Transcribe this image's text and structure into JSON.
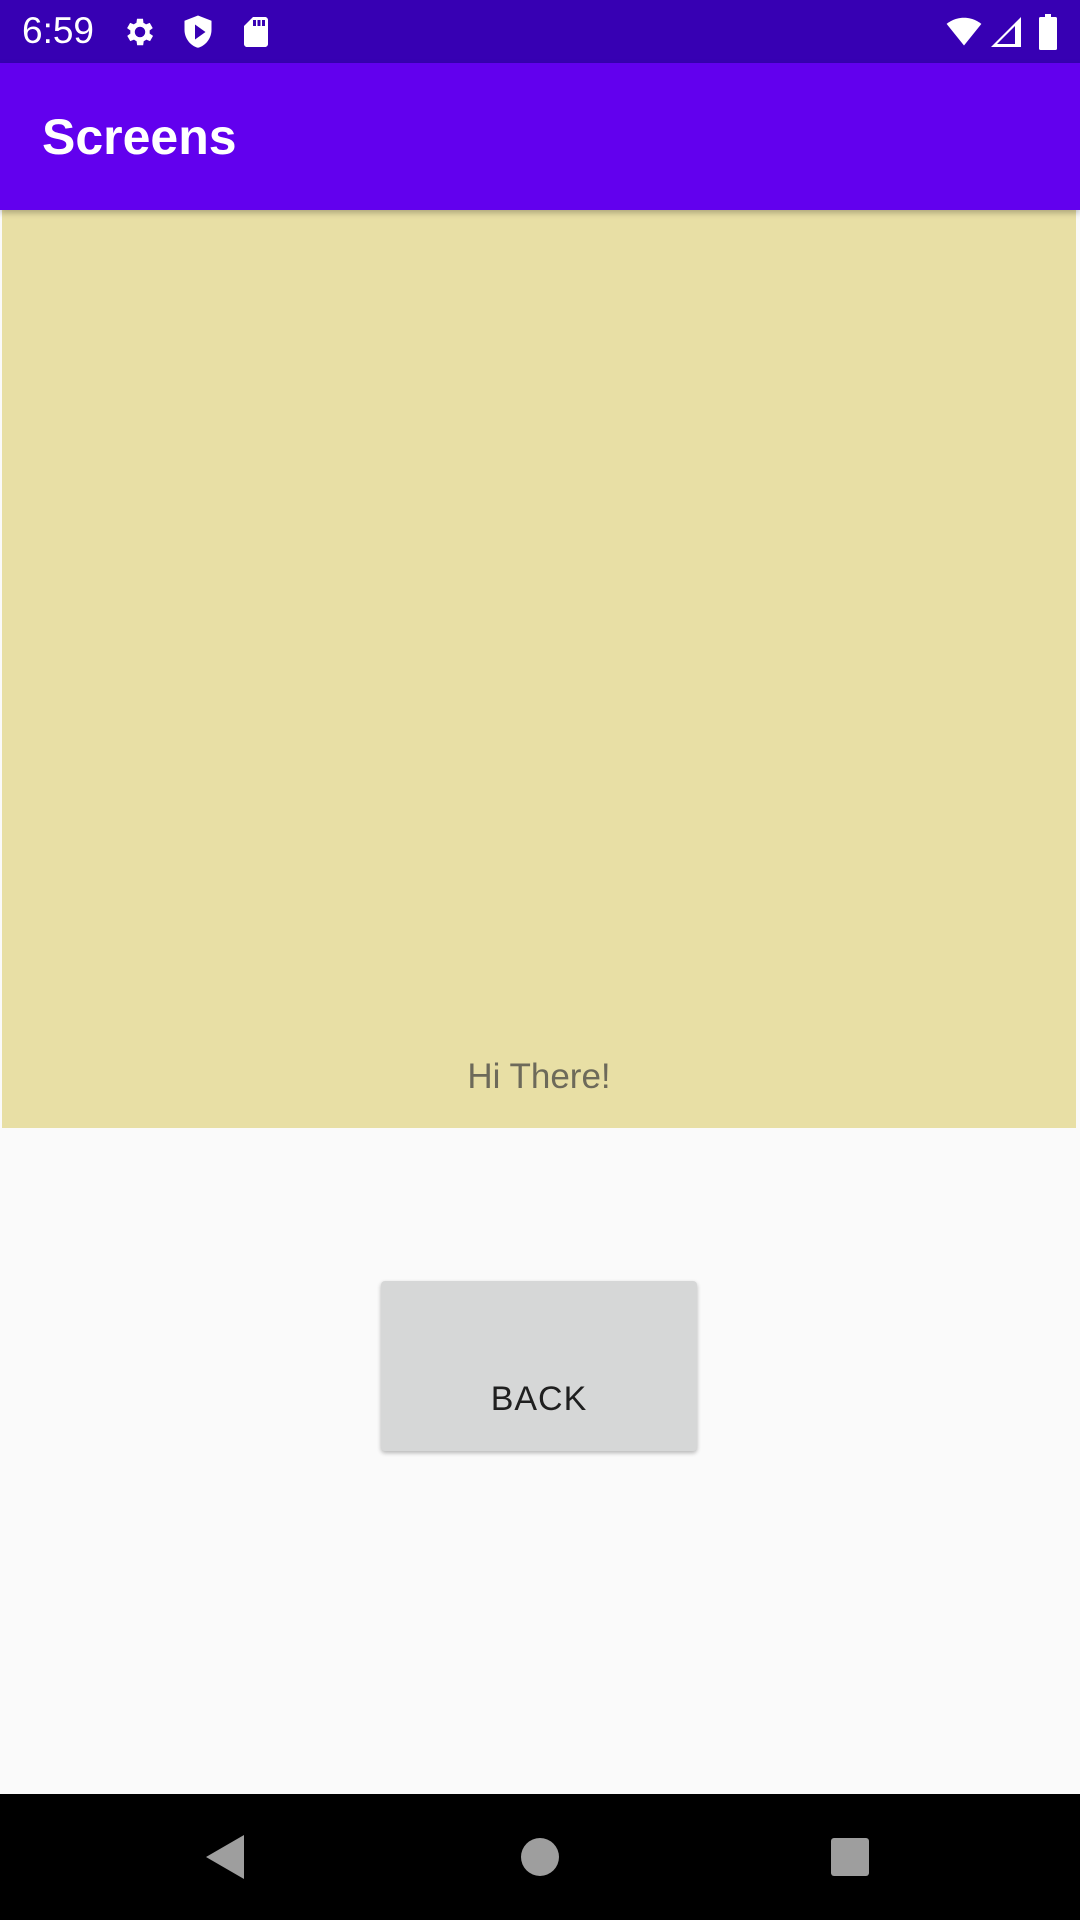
{
  "status_bar": {
    "time": "6:59",
    "icons": [
      "gear-icon",
      "shield-play-icon",
      "sd-card-icon",
      "wifi-icon",
      "signal-icon",
      "battery-icon"
    ],
    "background": "#3700b3"
  },
  "app_bar": {
    "title": "Screens",
    "background": "#6200ee"
  },
  "panel": {
    "text": "Hi There!",
    "background": "#e8dfa5"
  },
  "back_button": {
    "label": "BACK",
    "background": "#d6d7d7"
  },
  "nav_bar": {
    "buttons": [
      "back-triangle-icon",
      "home-circle-icon",
      "recents-square-icon"
    ]
  }
}
